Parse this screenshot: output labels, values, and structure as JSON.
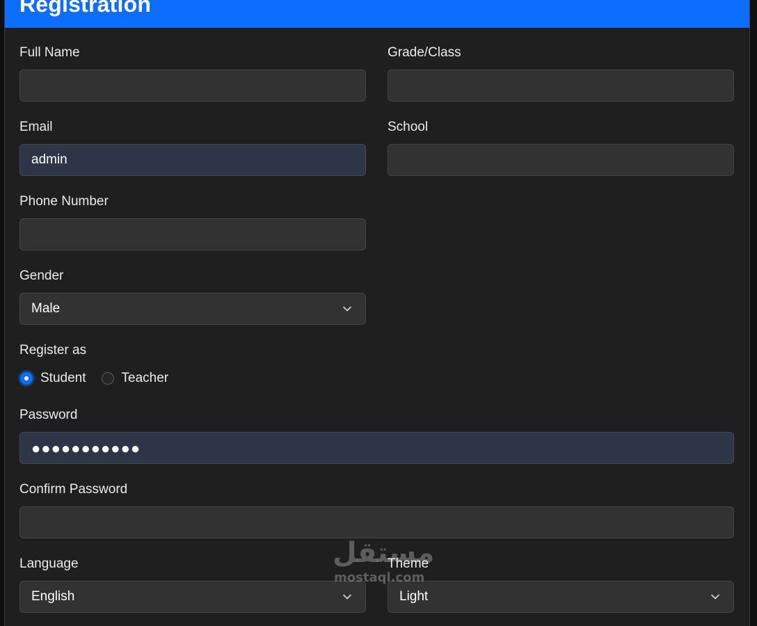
{
  "header": {
    "title": "Registration",
    "color": "#0d6efd"
  },
  "form": {
    "full_name": {
      "label": "Full Name",
      "value": ""
    },
    "grade_class": {
      "label": "Grade/Class",
      "value": ""
    },
    "email": {
      "label": "Email",
      "value": "admin"
    },
    "school": {
      "label": "School",
      "value": ""
    },
    "phone": {
      "label": "Phone Number",
      "value": ""
    },
    "gender": {
      "label": "Gender",
      "selected": "Male"
    },
    "register_as": {
      "label": "Register as",
      "options": [
        {
          "label": "Student",
          "checked": true
        },
        {
          "label": "Teacher",
          "checked": false
        }
      ]
    },
    "password": {
      "label": "Password",
      "value": "●●●●●●●●●●●"
    },
    "confirm_password": {
      "label": "Confirm Password",
      "value": ""
    },
    "language": {
      "label": "Language",
      "selected": "English"
    },
    "theme": {
      "label": "Theme",
      "selected": "Light"
    }
  },
  "watermark": {
    "arabic": "مستقل",
    "latin": "mostaql.com"
  },
  "icons": {
    "dropdown": "chevron-down-icon"
  }
}
